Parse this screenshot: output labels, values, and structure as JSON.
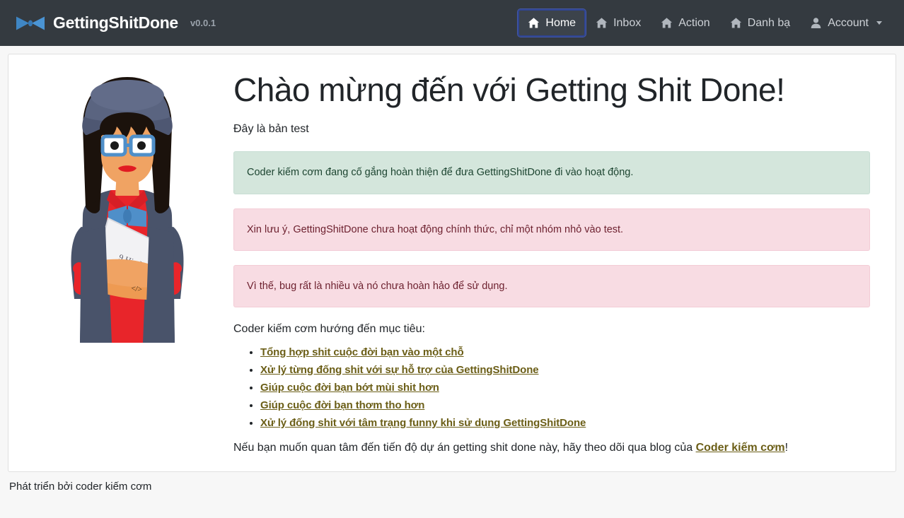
{
  "navbar": {
    "brand": {
      "name": "GettingShitDone",
      "version": "v0.0.1",
      "logo_icon": "bowtie-icon"
    },
    "items": [
      {
        "label": "Home",
        "icon": "home-icon",
        "active": true
      },
      {
        "label": "Inbox",
        "icon": "home-icon",
        "active": false
      },
      {
        "label": "Action",
        "icon": "home-icon",
        "active": false
      },
      {
        "label": "Danh bạ",
        "icon": "home-icon",
        "active": false
      },
      {
        "label": "Account",
        "icon": "person-icon",
        "active": false,
        "has_caret": true
      }
    ],
    "bg_color": "#343a40",
    "active_outline_color": "#2f4490"
  },
  "main": {
    "illustration_name": "woman-with-beanie-glasses-illustration",
    "title": "Chào mừng đến với Getting Shit Done!",
    "lead": "Đây là bản test",
    "alerts": [
      {
        "type": "success",
        "text": "Coder kiếm cơm đang cố gắng hoàn thiện để đưa GettingShitDone đi vào hoạt động.",
        "bg_color": "#d4e6dc",
        "text_color": "#1d4531"
      },
      {
        "type": "danger",
        "text": "Xin lưu ý, GettingShitDone chưa hoạt động chính thức, chỉ một nhóm nhỏ vào test.",
        "bg_color": "#f8dce3",
        "text_color": "#6e2230"
      },
      {
        "type": "danger",
        "text": "Vì thế, bug rất là nhiều và nó chưa hoàn hảo để sử dụng.",
        "bg_color": "#f8dce3",
        "text_color": "#6e2230"
      }
    ],
    "goals_intro": "Coder kiếm cơm hướng đến mục tiêu:",
    "goals": [
      "Tổng hợp shit cuộc đời bạn vào một chỗ",
      "Xử lý từng đống shit với sự hỗ trợ của GettingShitDone",
      "Giúp cuộc đời bạn bớt mùi shit hơn",
      "Giúp cuộc đời bạn thơm tho hơn",
      "Xử lý đống shit với tâm trạng funny khi sử dụng GettingShitDone"
    ],
    "outro_before": "Nếu bạn muốn quan tâm đến tiến độ dự án getting shit done này, hãy theo dõi qua blog của ",
    "outro_link": "Coder kiếm cơm",
    "outro_after": "!",
    "link_color": "#6b5e17"
  },
  "footer": {
    "text": "Phát triển bởi coder kiếm cơm"
  }
}
